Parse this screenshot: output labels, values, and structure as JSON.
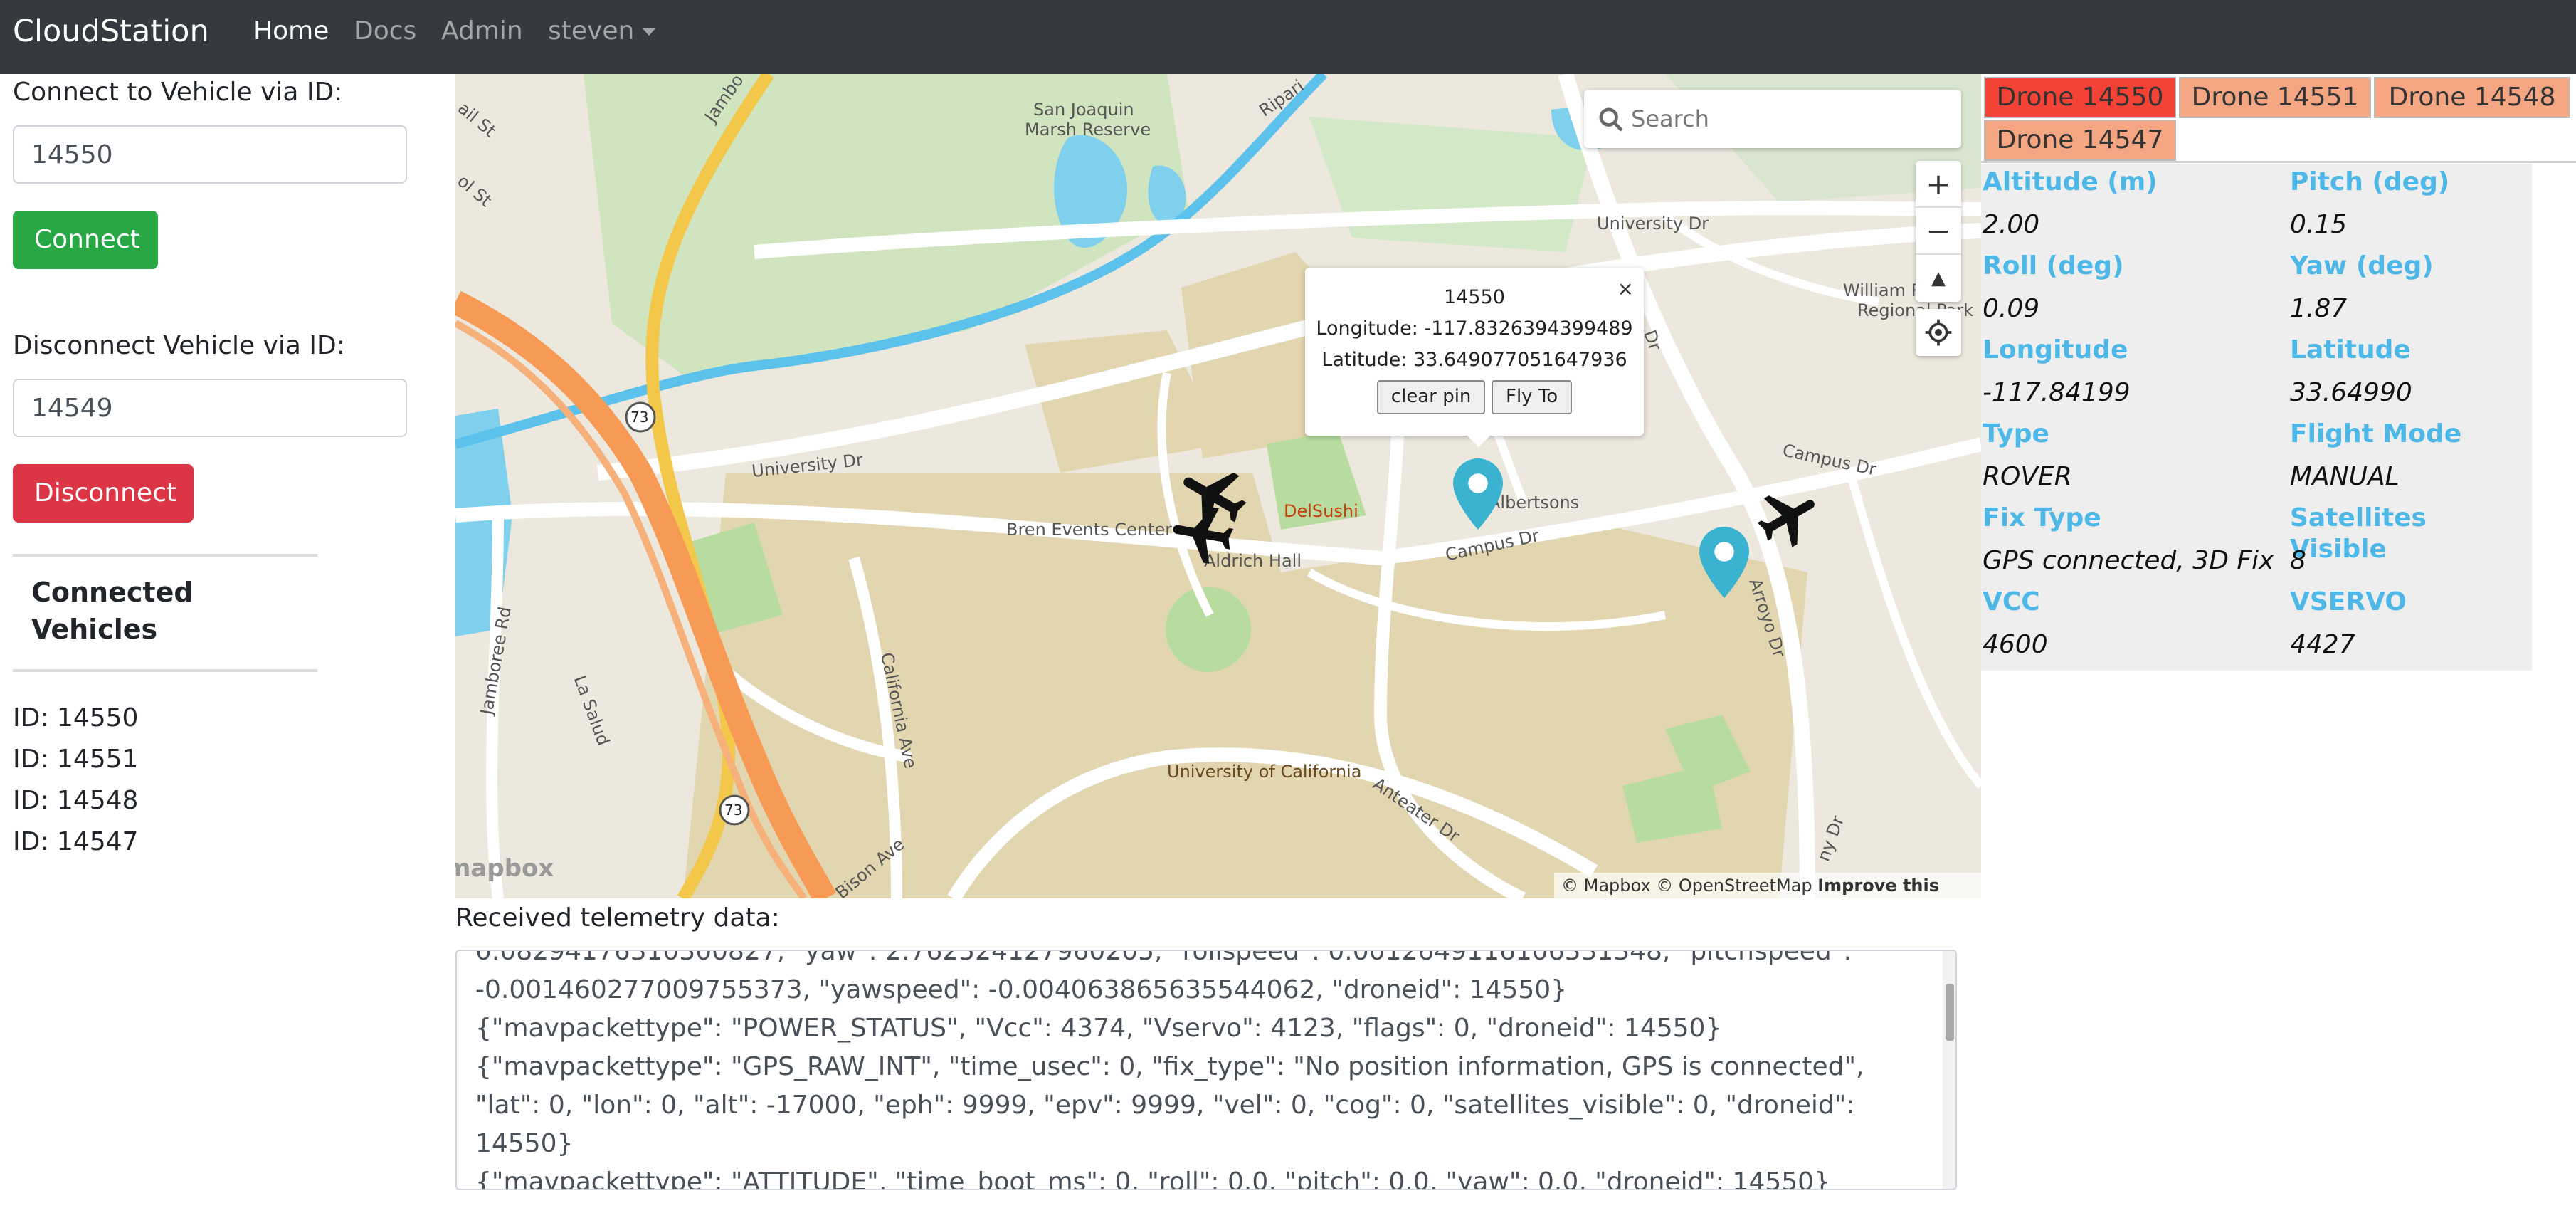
{
  "navbar": {
    "brand": "CloudStation",
    "links": [
      {
        "label": "Home",
        "active": true
      },
      {
        "label": "Docs",
        "active": false
      },
      {
        "label": "Admin",
        "active": false
      }
    ],
    "user_menu": "steven"
  },
  "connect": {
    "label": "Connect to Vehicle via ID:",
    "value": "14550",
    "button": "Connect"
  },
  "disconnect": {
    "label": "Disconnect Vehicle via ID:",
    "value": "14549",
    "button": "Disconnect"
  },
  "connected": {
    "heading": "Connected Vehicles",
    "items": [
      "ID: 14550",
      "ID: 14551",
      "ID: 14548",
      "ID: 14547"
    ]
  },
  "map": {
    "search_placeholder": "Search",
    "zoom_in": "+",
    "zoom_out": "−",
    "compass": "▲",
    "popup": {
      "title": "14550",
      "longitude": "Longitude: -117.8326394399489",
      "latitude": "Latitude: 33.649077051647936",
      "clear_button": "clear pin",
      "fly_button": "Fly To",
      "close": "×"
    },
    "labels": {
      "san_joaquin_1": "San Joaquin",
      "san_joaquin_2": "Marsh Reserve",
      "university_dr_top": "University Dr",
      "university_dr_left": "University Dr",
      "bren": "Bren Events Center",
      "aldrich": "Aldrich Hall",
      "delsushi": "DelSushi",
      "albertsons": "Albertsons",
      "campus_dr_mid": "Campus Dr",
      "campus_dr_right": "Campus Dr",
      "william_1": "William R",
      "william_2": "Regional Park",
      "uc": "University of California",
      "arroyo": "Arroyo Dr",
      "california_ave": "California Ave",
      "anteater": "Anteater Dr",
      "bison": "Bison Ave",
      "jamboree": "Jamboree Rd",
      "la_salud": "La Salud",
      "rail_st": "ail St",
      "ol_st": "ol St",
      "jambo_top": "Jambo",
      "ripari": "Ripari",
      "dr_right": "Dr",
      "route": "73",
      "campus_tail": "ny Dr"
    },
    "mapbox_logo": "mapbox",
    "attribution": "© Mapbox © OpenStreetMap",
    "improve": "Improve this map"
  },
  "drone_tabs": [
    {
      "label": "Drone 14550",
      "active": true
    },
    {
      "label": "Drone 14551",
      "active": false
    },
    {
      "label": "Drone 14548",
      "active": false
    },
    {
      "label": "Drone 14547",
      "active": false
    }
  ],
  "telemetry": {
    "altitude_label": "Altitude (m)",
    "altitude": "2.00",
    "pitch_label": "Pitch (deg)",
    "pitch": "0.15",
    "roll_label": "Roll (deg)",
    "roll": "0.09",
    "yaw_label": "Yaw (deg)",
    "yaw": "1.87",
    "longitude_label": "Longitude",
    "longitude": "-117.84199",
    "latitude_label": "Latitude",
    "latitude": "33.64990",
    "type_label": "Type",
    "type": "ROVER",
    "mode_label": "Flight Mode",
    "mode": "MANUAL",
    "fix_label": "Fix Type",
    "fix": "GPS connected, 3D Fix",
    "sats_label": "Satellites Visible",
    "sats": "8",
    "vcc_label": "VCC",
    "vcc": "4600",
    "vservo_label": "VSERVO",
    "vservo": "4427"
  },
  "received": {
    "label": "Received telemetry data:",
    "text": "0.08294176310300827, \"yaw\": 2.762524127960205, \"rollspeed\": 0.0012649116106331348, \"pitchspeed\":\n-0.001460277009755373, \"yawspeed\": -0.004063865635544062, \"droneid\": 14550}\n{\"mavpackettype\": \"POWER_STATUS\", \"Vcc\": 4374, \"Vservo\": 4123, \"flags\": 0, \"droneid\": 14550}\n{\"mavpackettype\": \"GPS_RAW_INT\", \"time_usec\": 0, \"fix_type\": \"No position information, GPS is connected\",\n\"lat\": 0, \"lon\": 0, \"alt\": -17000, \"eph\": 9999, \"epv\": 9999, \"vel\": 0, \"cog\": 0, \"satellites_visible\": 0, \"droneid\":\n14550}\n{\"mavpackettype\": \"ATTITUDE\", \"time_boot_ms\": 0, \"roll\": 0.0, \"pitch\": 0.0, \"yaw\": 0.0, \"droneid\": 14550}"
  },
  "colors": {
    "navbar": "#343a40",
    "connect": "#28a745",
    "disconnect": "#dc3545",
    "tab_active": "#f44336",
    "tab_inactive": "#f4a582",
    "telemetry_label": "#4db8e8",
    "pin": "#3bb2d0"
  }
}
